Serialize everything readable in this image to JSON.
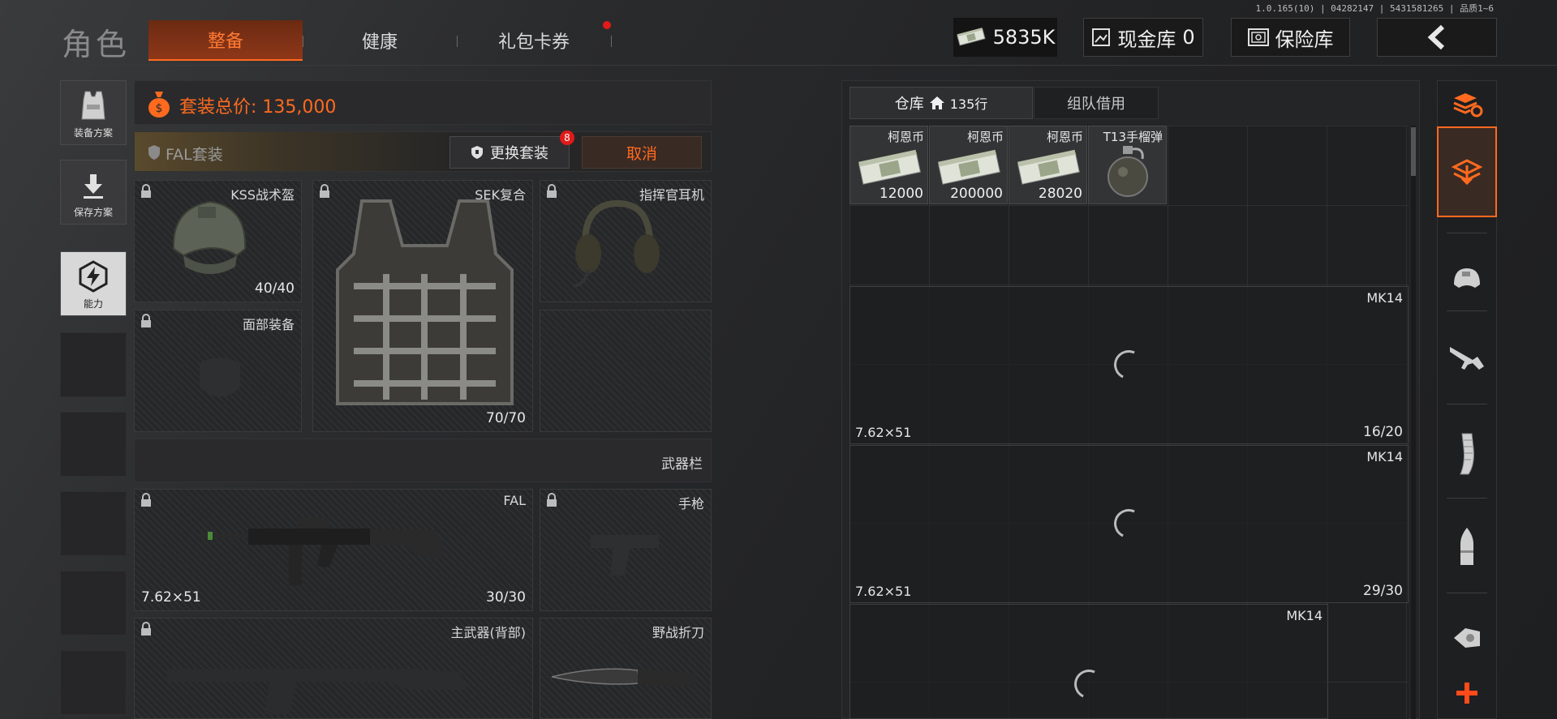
{
  "version": "1.0.165(10) | 04282147 | 5431581265 | 品质1~6",
  "title": "角色",
  "tabs": [
    {
      "label": "整备",
      "active": true
    },
    {
      "label": "健康",
      "active": false
    },
    {
      "label": "礼包卡券",
      "active": false,
      "badge_dot": true
    }
  ],
  "currency": {
    "amount": "5835K",
    "icon": "cash-stack-icon"
  },
  "cash_vault": {
    "label": "现金库",
    "value": "0"
  },
  "insurance": {
    "label": "保险库"
  },
  "back_icon": "chevron-left-icon",
  "left_nav": [
    {
      "label": "装备方案",
      "icon": "vest-icon"
    },
    {
      "label": "保存方案",
      "icon": "download-arrow-icon"
    },
    {
      "label": "能力",
      "icon": "ability-bolt-icon",
      "active": true
    }
  ],
  "loadout": {
    "total_label": "套装总价: ",
    "total_value": "135,000",
    "kit_name": "FAL套装",
    "swap_button": "更换套装",
    "swap_badge": "8",
    "cancel_button": "取消"
  },
  "slots": {
    "helmet": {
      "name": "KSS战术盔",
      "durability": "40/40"
    },
    "armor": {
      "name": "SEK复合",
      "durability": "70/70"
    },
    "headset": {
      "name": "指挥官耳机"
    },
    "face": {
      "name": "面部装备"
    },
    "weapons_header": "武器栏",
    "primary": {
      "name": "FAL",
      "caliber": "7.62×51",
      "ammo": "30/30"
    },
    "pistol": {
      "name": "手枪"
    },
    "back_weapon": {
      "name": "主武器(背部)"
    },
    "knife": {
      "name": "野战折刀"
    }
  },
  "warehouse": {
    "tab_storage": "仓库",
    "tab_storage_rows": "135行",
    "tab_team": "组队借用",
    "items": [
      {
        "name": "柯恩币",
        "count": "12000",
        "icon": "cash-stack-icon"
      },
      {
        "name": "柯恩币",
        "count": "200000",
        "icon": "cash-stack-icon"
      },
      {
        "name": "柯恩币",
        "count": "28020",
        "icon": "cash-stack-icon"
      },
      {
        "name": "T13手榴弹",
        "count": "",
        "icon": "grenade-icon"
      }
    ],
    "weapons": [
      {
        "name": "MK14",
        "caliber": "7.62×51",
        "ammo": "16/20"
      },
      {
        "name": "MK14",
        "caliber": "7.62×51",
        "ammo": "29/30"
      },
      {
        "name": "MK14",
        "caliber": "",
        "ammo": ""
      }
    ]
  },
  "right_rail": [
    {
      "icon": "stack-refresh-icon"
    },
    {
      "icon": "stack-download-icon",
      "active": true
    },
    {
      "icon": "helmet-icon"
    },
    {
      "icon": "rifle-icon"
    },
    {
      "icon": "magazine-icon"
    },
    {
      "icon": "bullet-icon"
    },
    {
      "icon": "scope-icon"
    },
    {
      "icon": "plus-icon"
    }
  ],
  "colors": {
    "accent": "#ff6a1f",
    "active_tab_bg": "#8e3718",
    "badge_red": "#e11a1a"
  }
}
